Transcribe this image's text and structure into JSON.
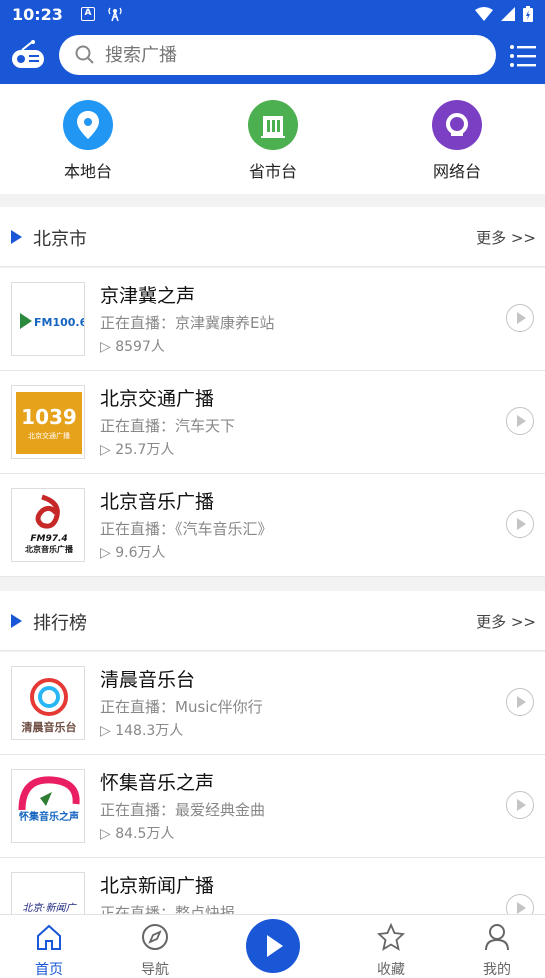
{
  "status": {
    "time": "10:23"
  },
  "search": {
    "placeholder": "搜索广播"
  },
  "categories": [
    {
      "label": "本地台",
      "color": "#2196f3"
    },
    {
      "label": "省市台",
      "color": "#4caf50"
    },
    {
      "label": "网络台",
      "color": "#7b3fc4"
    }
  ],
  "section_local": {
    "title": "北京市",
    "more": "更多 >>",
    "items": [
      {
        "name": "京津冀之声",
        "now": "正在直播：京津冀康养E站",
        "listeners": "▷ 8597人",
        "logo_text": "FM100.6"
      },
      {
        "name": "北京交通广播",
        "now": "正在直播：汽车天下",
        "listeners": "▷ 25.7万人",
        "logo_text": "1039",
        "logo_sub": "北京交通广播"
      },
      {
        "name": "北京音乐广播",
        "now": "正在直播：《汽车音乐汇》",
        "listeners": "▷ 9.6万人",
        "logo_text": "FM97.4",
        "logo_sub": "北京音乐广播"
      }
    ]
  },
  "section_rank": {
    "title": "排行榜",
    "more": "更多 >>",
    "items": [
      {
        "name": "清晨音乐台",
        "now": "正在直播：Music伴你行",
        "listeners": "▷ 148.3万人",
        "logo_text": "清晨音乐台"
      },
      {
        "name": "怀集音乐之声",
        "now": "正在直播：最爱经典金曲",
        "listeners": "▷ 84.5万人",
        "logo_text": "怀集音乐之声"
      },
      {
        "name": "北京新闻广播",
        "now": "正在直播：整点快报",
        "listeners": "",
        "logo_text": "北京·新闻广"
      }
    ]
  },
  "tabs": [
    {
      "label": "首页",
      "icon": "home-icon",
      "active": true
    },
    {
      "label": "导航",
      "icon": "compass-icon"
    },
    {
      "label": "收藏",
      "icon": "star-icon"
    },
    {
      "label": "我的",
      "icon": "user-icon"
    }
  ],
  "colors": {
    "primary": "#1a57d6"
  }
}
